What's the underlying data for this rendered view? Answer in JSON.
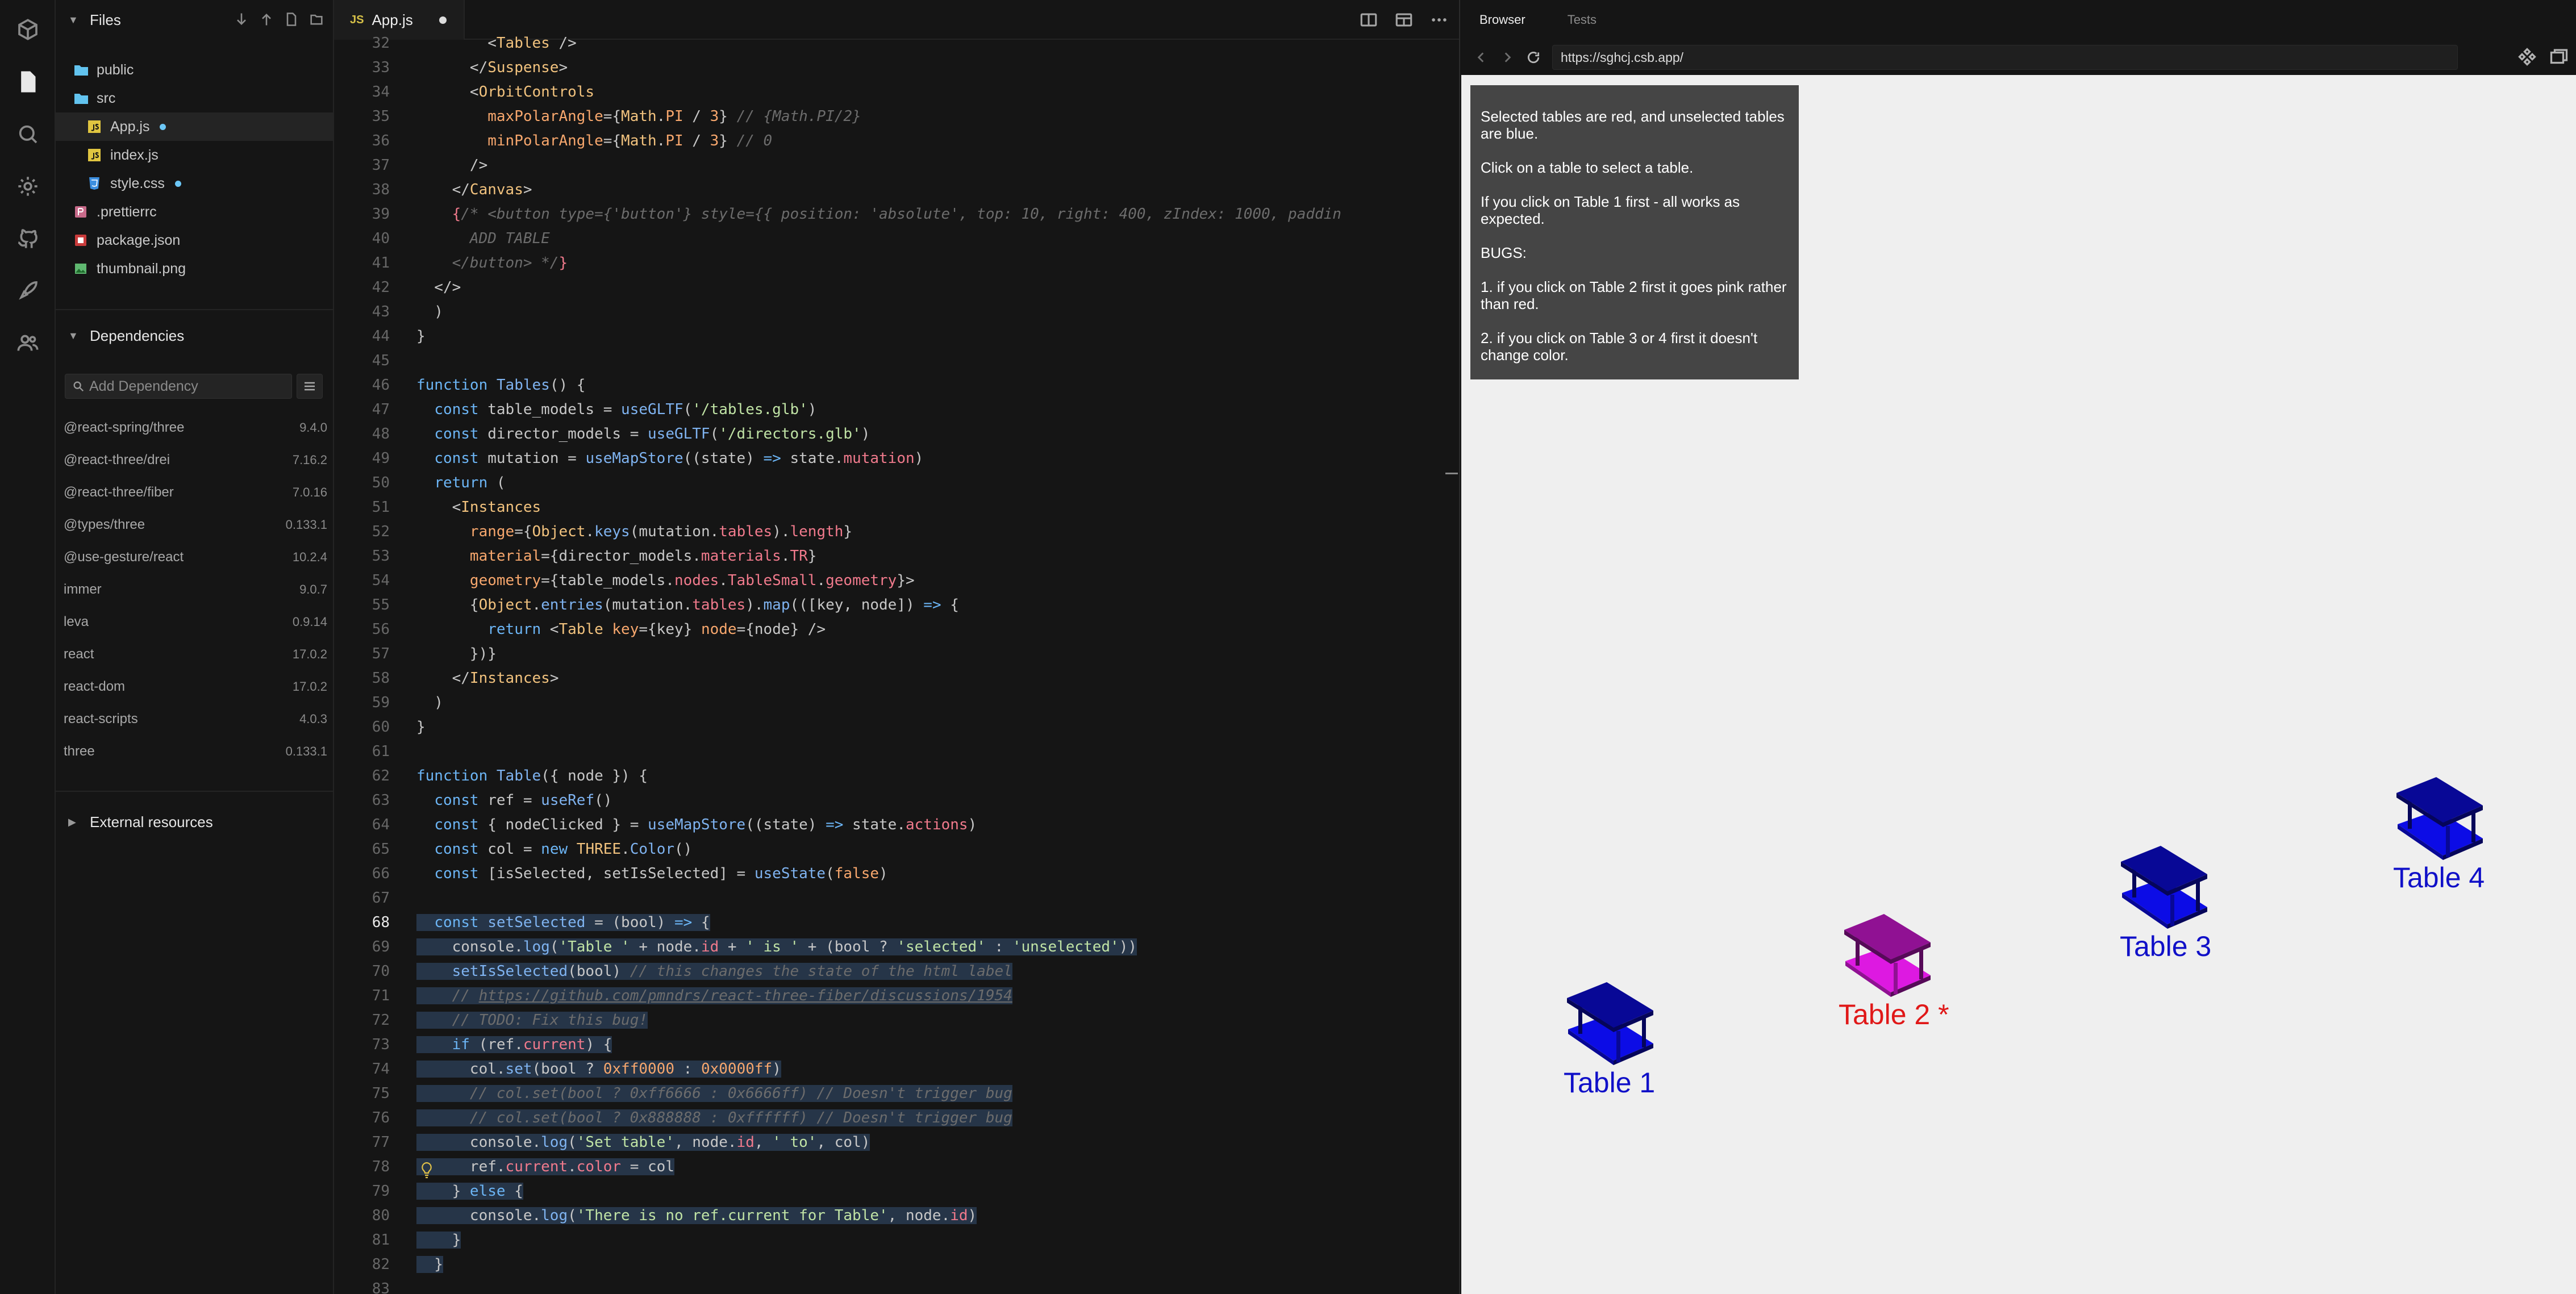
{
  "sidebar": {
    "files_title": "Files",
    "file_tree": [
      {
        "name": "public",
        "type": "folder"
      },
      {
        "name": "src",
        "type": "folder"
      },
      {
        "name": "App.js",
        "type": "js",
        "modified": true,
        "selected": true
      },
      {
        "name": "index.js",
        "type": "js"
      },
      {
        "name": "style.css",
        "type": "css",
        "modified": true
      },
      {
        "name": ".prettierrc",
        "type": "prettier"
      },
      {
        "name": "package.json",
        "type": "json"
      },
      {
        "name": "thumbnail.png",
        "type": "image"
      }
    ],
    "dependencies_title": "Dependencies",
    "add_dependency_placeholder": "Add Dependency",
    "dependencies": [
      {
        "name": "@react-spring/three",
        "version": "9.4.0"
      },
      {
        "name": "@react-three/drei",
        "version": "7.16.2"
      },
      {
        "name": "@react-three/fiber",
        "version": "7.0.16"
      },
      {
        "name": "@types/three",
        "version": "0.133.1"
      },
      {
        "name": "@use-gesture/react",
        "version": "10.2.4"
      },
      {
        "name": "immer",
        "version": "9.0.7"
      },
      {
        "name": "leva",
        "version": "0.9.14"
      },
      {
        "name": "react",
        "version": "17.0.2"
      },
      {
        "name": "react-dom",
        "version": "17.0.2"
      },
      {
        "name": "react-scripts",
        "version": "4.0.3"
      },
      {
        "name": "three",
        "version": "0.133.1"
      }
    ],
    "external_title": "External resources"
  },
  "editor": {
    "tab_badge": "JS",
    "tab_name": "App.js",
    "current_line": 68
  },
  "preview": {
    "tab_browser": "Browser",
    "tab_tests": "Tests",
    "url": "https://sghcj.csb.app/",
    "info_lines": [
      "Selected tables are red, and unselected tables are blue.",
      "Click on a table to select a table.",
      "If you click on Table 1 first - all works as expected.",
      "BUGS:",
      "1. if you click on Table 2 first it goes pink rather than red.",
      "2. if you click on Table 3 or 4 first it doesn't change color."
    ],
    "tables": [
      {
        "label": "Table 1",
        "color": "#0a0ac8",
        "label_color": "#1010c8"
      },
      {
        "label": "Table 2 *",
        "color": "#c016c4",
        "label_color": "#e01818"
      },
      {
        "label": "Table 3",
        "color": "#0a0ac8",
        "label_color": "#1010c8"
      },
      {
        "label": "Table 4",
        "color": "#0a0ac8",
        "label_color": "#1010c8"
      }
    ]
  },
  "colors": {
    "accent_dot": "#6cc7f6",
    "selection": "#263548"
  }
}
